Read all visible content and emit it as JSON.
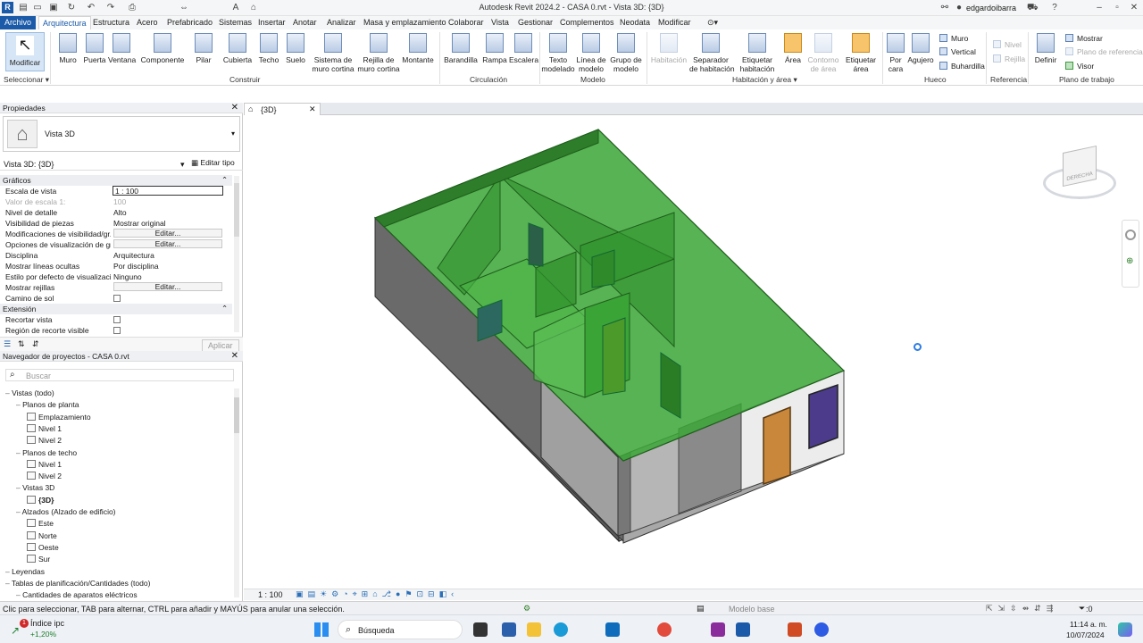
{
  "titlebar": {
    "title": "Autodesk Revit 2024.2 - CASA 0.rvt - Vista 3D: {3D}",
    "user": "edgardoibarra"
  },
  "menu": [
    "Archivo",
    "Arquitectura",
    "Estructura",
    "Acero",
    "Prefabricado",
    "Sistemas",
    "Insertar",
    "Anotar",
    "Analizar",
    "Masa y emplazamiento",
    "Colaborar",
    "Vista",
    "Gestionar",
    "Complementos",
    "Neodata",
    "Modificar"
  ],
  "ribbon": {
    "modificar": "Modificar",
    "seleccionar": "Seleccionar",
    "construir": [
      "Muro",
      "Puerta",
      "Ventana",
      "Componente",
      "Pilar",
      "Cubierta",
      "Techo",
      "Suelo",
      "Sistema de",
      "muro cortina",
      "Rejilla de",
      "muro cortina",
      "Montante"
    ],
    "construir_label": "Construir",
    "circulacion": [
      "Barandilla",
      "Rampa",
      "Escalera"
    ],
    "circulacion_label": "Circulación",
    "modelo": [
      "Texto",
      "modelado",
      "Línea de",
      "modelo",
      "Grupo de",
      "modelo"
    ],
    "modelo_label": "Modelo",
    "habitacion": [
      "Habitación",
      "Separador",
      "de habitación",
      "Etiquetar",
      "habitación",
      "Área",
      "Contorno",
      "de área",
      "Etiquetar",
      "área"
    ],
    "habitacion_label": "Habitación y área",
    "hueco": [
      "Por",
      "cara",
      "Agujero",
      "Muro",
      "Vertical",
      "Buhardilla"
    ],
    "hueco_label": "Hueco",
    "referencia": [
      "Nivel",
      "Rejilla"
    ],
    "referencia_label": "Referencia",
    "plano": [
      "Definir",
      "Mostrar",
      "Plano de referencia",
      "Visor"
    ],
    "plano_label": "Plano de trabajo"
  },
  "properties": {
    "title": "Propiedades",
    "type": "Vista 3D",
    "instance": "Vista 3D: {3D}",
    "edit_type": "Editar tipo",
    "group1": "Gráficos",
    "rows": [
      {
        "k": "Escala de vista",
        "v": "1 : 100"
      },
      {
        "k": "Valor de escala    1:",
        "v": "100"
      },
      {
        "k": "Nivel de detalle",
        "v": "Alto"
      },
      {
        "k": "Visibilidad de piezas",
        "v": "Mostrar original"
      },
      {
        "k": "Modificaciones de visibilidad/gr...",
        "v": "Editar..."
      },
      {
        "k": "Opciones de visualización de gr...",
        "v": "Editar..."
      },
      {
        "k": "Disciplina",
        "v": "Arquitectura"
      },
      {
        "k": "Mostrar líneas ocultas",
        "v": "Por disciplina"
      },
      {
        "k": "Estilo por defecto de visualizaci...",
        "v": "Ninguno"
      },
      {
        "k": "Mostrar rejillas",
        "v": "Editar..."
      },
      {
        "k": "Camino de sol",
        "v": ""
      }
    ],
    "group2": "Extensión",
    "rows2": [
      {
        "k": "Recortar vista"
      },
      {
        "k": "Región de recorte visible"
      }
    ],
    "apply": "Aplicar"
  },
  "browser": {
    "title": "Navegador de proyectos - CASA 0.rvt",
    "search": "Buscar",
    "nodes": [
      {
        "t": "Vistas (todo)",
        "lvl": 0
      },
      {
        "t": "Planos de planta",
        "lvl": 1
      },
      {
        "t": "Emplazamiento",
        "lvl": 2
      },
      {
        "t": "Nivel 1",
        "lvl": 2
      },
      {
        "t": "Nivel 2",
        "lvl": 2
      },
      {
        "t": "Planos de techo",
        "lvl": 1
      },
      {
        "t": "Nivel 1",
        "lvl": 2
      },
      {
        "t": "Nivel 2",
        "lvl": 2
      },
      {
        "t": "Vistas 3D",
        "lvl": 1
      },
      {
        "t": "{3D}",
        "lvl": 2
      },
      {
        "t": "Alzados (Alzado de edificio)",
        "lvl": 1
      },
      {
        "t": "Este",
        "lvl": 2
      },
      {
        "t": "Norte",
        "lvl": 2
      },
      {
        "t": "Oeste",
        "lvl": 2
      },
      {
        "t": "Sur",
        "lvl": 2
      },
      {
        "t": "Leyendas",
        "lvl": 0
      },
      {
        "t": "Tablas de planificación/Cantidades (todo)",
        "lvl": 0
      },
      {
        "t": "Cantidades de aparatos eléctricos",
        "lvl": 1
      }
    ]
  },
  "view": {
    "tab": "{3D}",
    "scale": "1 : 100",
    "viewcube": "DERECHA",
    "model": "Modelo base",
    "filters": ":0"
  },
  "status": {
    "hint": "Clic para seleccionar, TAB para alternar, CTRL para añadir y MAYÚS para anular una selección."
  },
  "taskbar": {
    "widget_title": "Índice ipc",
    "widget_value": "+1,20%",
    "search": "Búsqueda",
    "time": "11:14 a. m.",
    "date": "10/07/2024",
    "notif": "1"
  },
  "colors": {
    "green": "#3aa635",
    "accent": "#1b5aa8"
  }
}
